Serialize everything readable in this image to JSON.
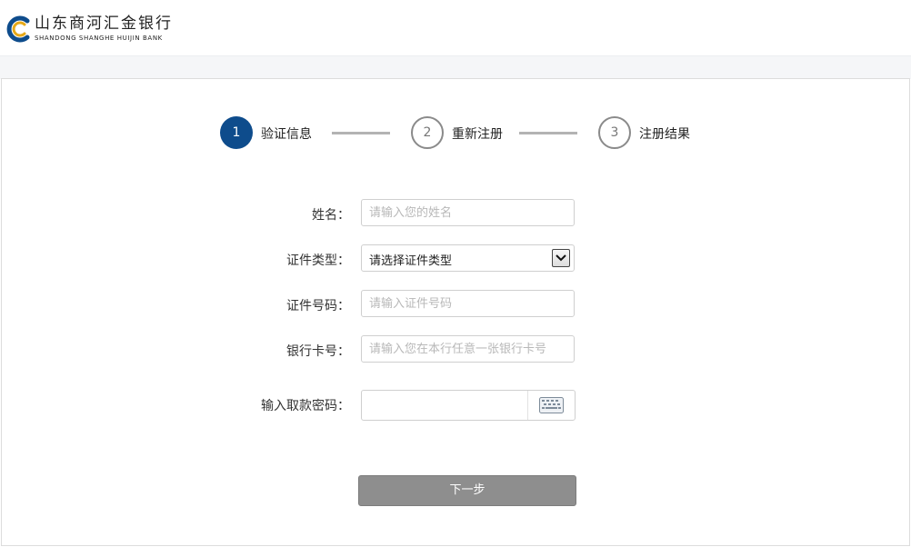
{
  "header": {
    "bank_name_cn": "山东商河汇金银行",
    "bank_name_en": "SHANDONG SHANGHE HUIJIN BANK",
    "brand_color": "#0e4c8c",
    "accent_color": "#e6a919"
  },
  "steps": [
    {
      "number": "1",
      "label": "验证信息",
      "state": "active"
    },
    {
      "number": "2",
      "label": "重新注册",
      "state": "pending"
    },
    {
      "number": "3",
      "label": "注册结果",
      "state": "pending"
    }
  ],
  "form": {
    "name": {
      "label": "姓名：",
      "placeholder": "请输入您的姓名",
      "value": ""
    },
    "id_type": {
      "label": "证件类型：",
      "selected": "请选择证件类型"
    },
    "id_number": {
      "label": "证件号码：",
      "placeholder": "请输入证件号码",
      "value": ""
    },
    "card_number": {
      "label": "银行卡号：",
      "placeholder": "请输入您在本行任意一张银行卡号",
      "value": ""
    },
    "pin": {
      "label": "输入取款密码：",
      "value": "",
      "keyboard_icon": "keyboard-icon"
    }
  },
  "next_button": {
    "label": "下一步",
    "color": "#8e8e8e"
  }
}
